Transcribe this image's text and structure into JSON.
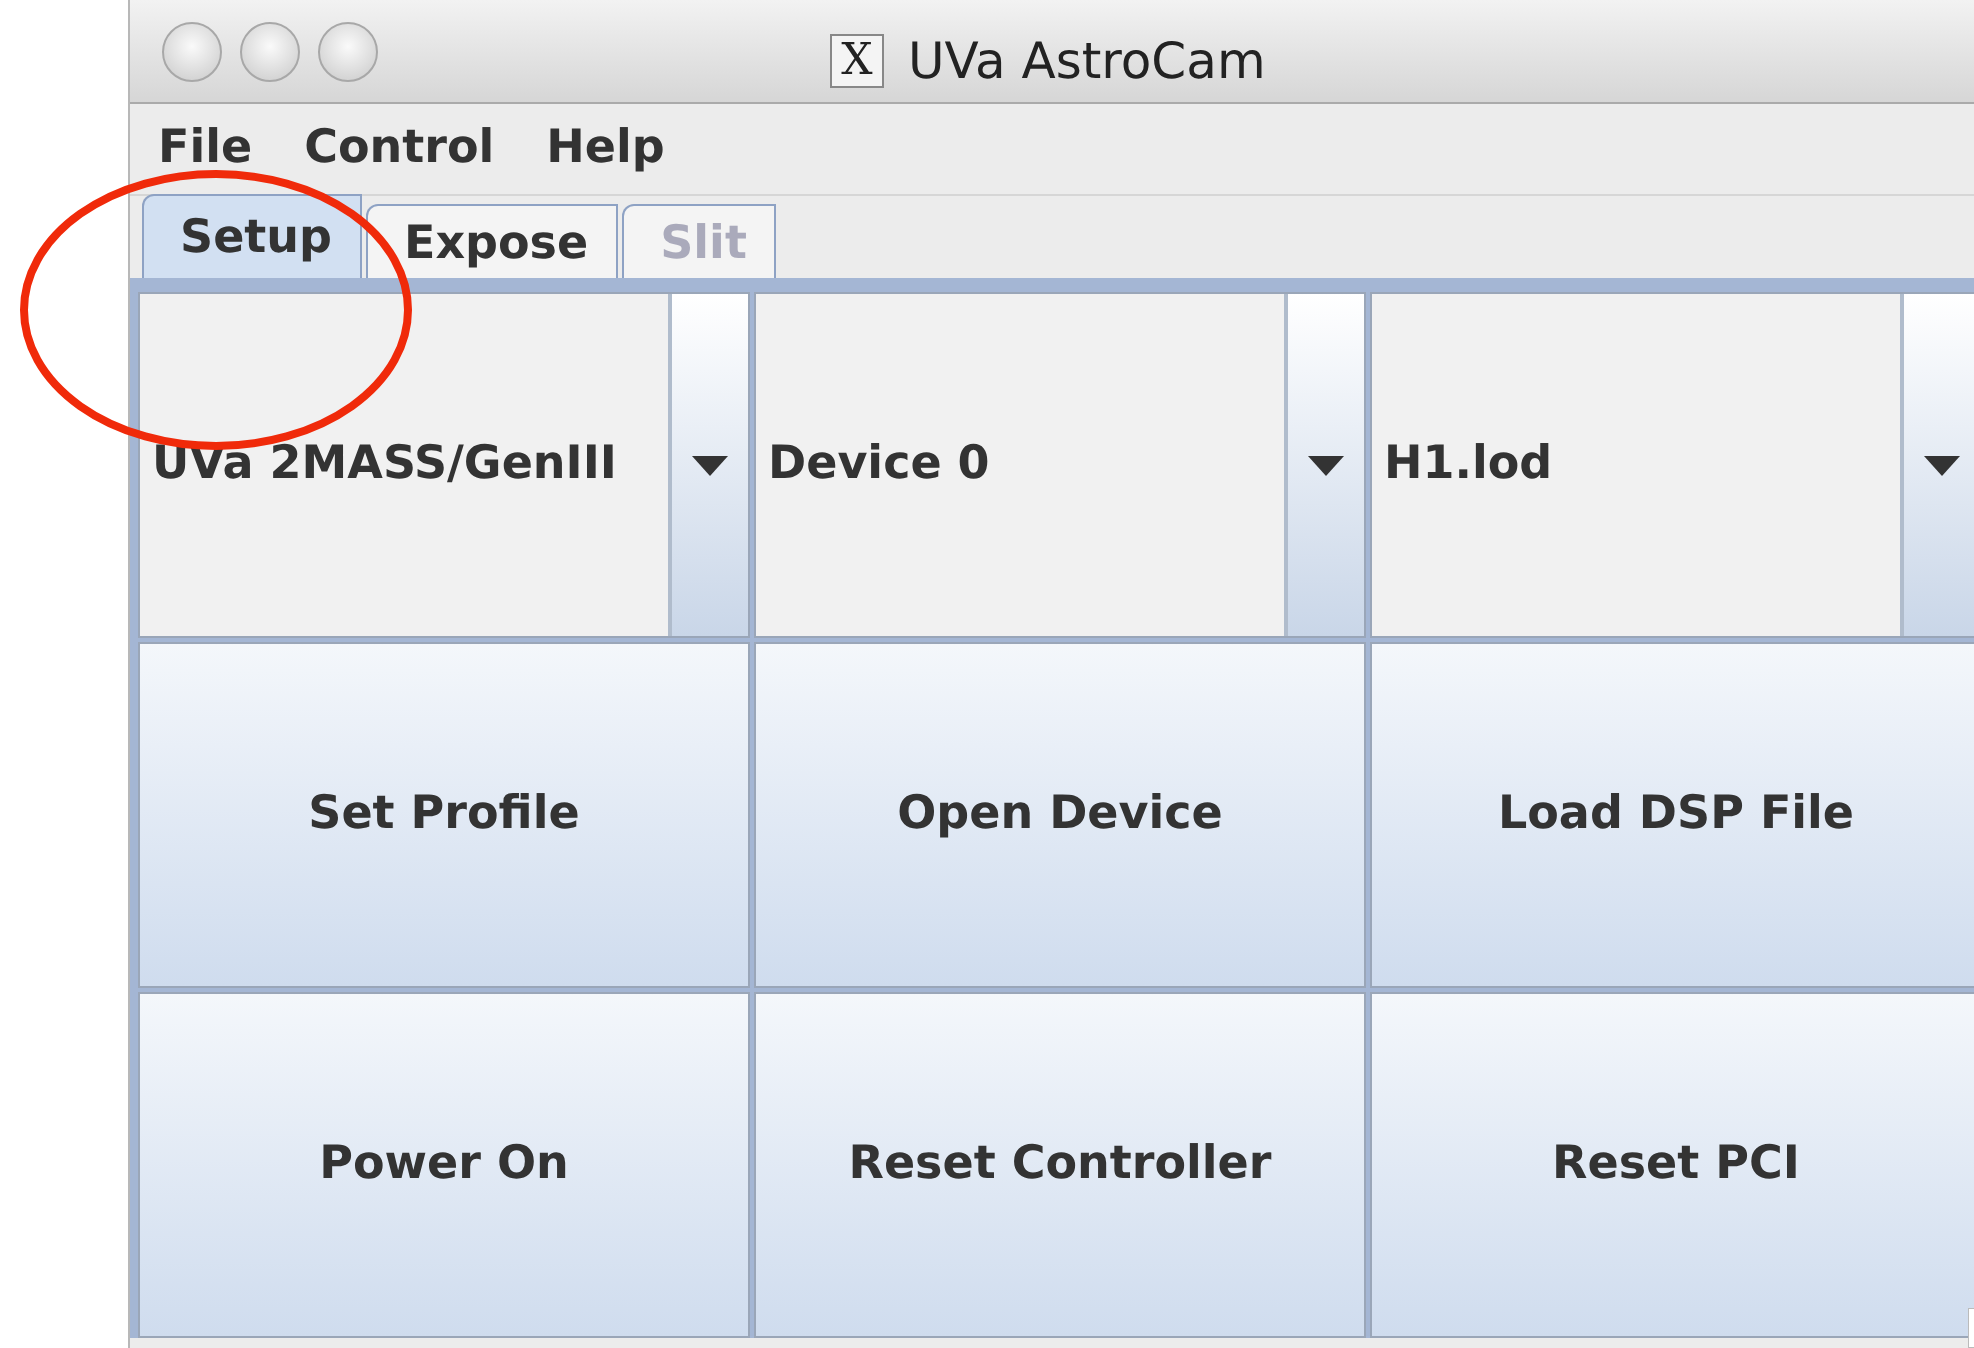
{
  "window": {
    "title": "UVa AstroCam",
    "title_icon": "X"
  },
  "menu": [
    "File",
    "Control",
    "Help"
  ],
  "tabs": [
    {
      "label": "Setup",
      "selected": true,
      "disabled": false
    },
    {
      "label": "Expose",
      "selected": false,
      "disabled": false
    },
    {
      "label": "Slit",
      "selected": false,
      "disabled": true
    }
  ],
  "dropdowns": [
    {
      "value": "UVa 2MASS/GenIII"
    },
    {
      "value": "Device 0"
    },
    {
      "value": "H1.lod"
    }
  ],
  "buttons": [
    "Set Profile",
    "Open Device",
    "Load DSP File",
    "Power On",
    "Reset Controller",
    "Reset PCI"
  ]
}
